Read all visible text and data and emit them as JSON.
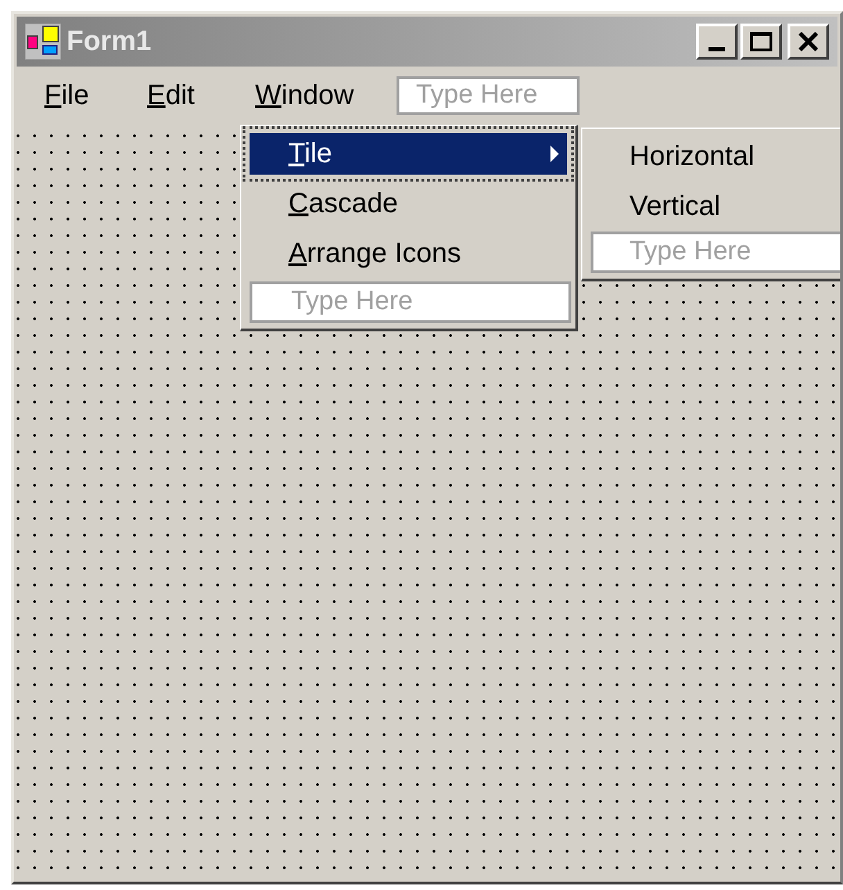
{
  "window": {
    "title": "Form1"
  },
  "menu_bar": {
    "items": [
      {
        "label": "File"
      },
      {
        "label": "Edit"
      },
      {
        "label": "Window"
      }
    ],
    "placeholder": "Type Here"
  },
  "dropdown": {
    "items": [
      {
        "label": "Tile",
        "selected": true,
        "submenu": {
          "items": [
            {
              "label": "Horizontal"
            },
            {
              "label": "Vertical"
            }
          ],
          "placeholder": "Type Here"
        }
      },
      {
        "label": "Cascade",
        "selected": false
      },
      {
        "label": "Arrange Icons",
        "selected": false
      }
    ],
    "placeholder": "Type Here"
  }
}
